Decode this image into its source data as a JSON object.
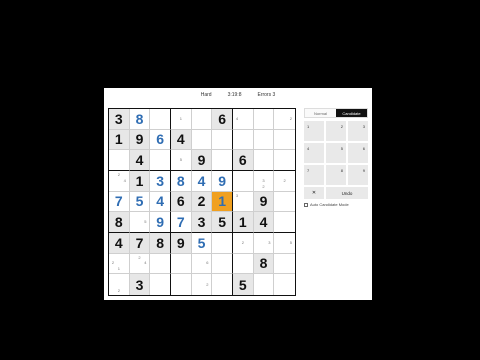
{
  "header": {
    "difficulty": "Hard",
    "timer": "3:19:8",
    "score": "Errors 3"
  },
  "board": {
    "rows": [
      [
        {
          "v": "3",
          "t": "given"
        },
        {
          "v": "8",
          "t": "user"
        },
        {
          "n": [
            "",
            "",
            " ",
            "",
            "",
            "",
            " ",
            "",
            ""
          ]
        },
        {
          "n": [
            "",
            "",
            "",
            "",
            "1",
            "",
            "",
            "",
            ""
          ]
        },
        {
          "v": ""
        },
        {
          "v": "6",
          "t": "given"
        },
        {
          "n": [
            "",
            "",
            "",
            "4",
            "",
            "",
            "",
            "",
            ""
          ]
        },
        {
          "v": ""
        },
        {
          "n": [
            "",
            "",
            "",
            "",
            "",
            "2",
            "",
            "",
            ""
          ]
        }
      ],
      [
        {
          "v": "1",
          "t": "given"
        },
        {
          "v": "9",
          "t": "given"
        },
        {
          "v": "6",
          "t": "user"
        },
        {
          "v": "4",
          "t": "given"
        },
        {
          "v": ""
        },
        {
          "v": ""
        },
        {
          "v": ""
        },
        {
          "v": ""
        },
        {
          "v": ""
        }
      ],
      [
        {
          "v": ""
        },
        {
          "v": "4",
          "t": "given"
        },
        {
          "v": ""
        },
        {
          "n": [
            "",
            "",
            "",
            "",
            "5",
            "",
            "",
            "",
            ""
          ]
        },
        {
          "v": "9",
          "t": "given"
        },
        {
          "v": ""
        },
        {
          "v": "6",
          "t": "given"
        },
        {
          "v": ""
        },
        {
          "v": ""
        }
      ],
      [
        {
          "n": [
            "",
            "2",
            "",
            "",
            "",
            "4",
            "",
            "",
            ""
          ]
        },
        {
          "v": "1",
          "t": "given"
        },
        {
          "v": "3",
          "t": "user"
        },
        {
          "v": "8",
          "t": "user"
        },
        {
          "v": "4",
          "t": "user"
        },
        {
          "v": "9",
          "t": "user"
        },
        {
          "v": ""
        },
        {
          "n": [
            "",
            "",
            "",
            "",
            "3",
            "",
            "",
            "2",
            ""
          ]
        },
        {
          "n": [
            "",
            "",
            "",
            "",
            "2",
            "",
            "",
            "",
            ""
          ]
        }
      ],
      [
        {
          "v": "7",
          "t": "user"
        },
        {
          "v": "5",
          "t": "user"
        },
        {
          "v": "4",
          "t": "user"
        },
        {
          "v": "6",
          "t": "given"
        },
        {
          "v": "2",
          "t": "given"
        },
        {
          "v": "1",
          "t": "selected"
        },
        {
          "n": [
            "3",
            "",
            "",
            "",
            "",
            "",
            "",
            "",
            ""
          ]
        },
        {
          "v": "9",
          "t": "given"
        },
        {
          "v": ""
        }
      ],
      [
        {
          "v": "8",
          "t": "given"
        },
        {
          "n": [
            "",
            "",
            "",
            "",
            "",
            "5",
            "",
            "",
            ""
          ]
        },
        {
          "v": "9",
          "t": "user"
        },
        {
          "v": "7",
          "t": "user"
        },
        {
          "v": "3",
          "t": "given"
        },
        {
          "v": "5",
          "t": "given"
        },
        {
          "v": "1",
          "t": "given"
        },
        {
          "v": "4",
          "t": "given"
        },
        {
          "v": ""
        }
      ],
      [
        {
          "v": "4",
          "t": "given"
        },
        {
          "v": "7",
          "t": "given"
        },
        {
          "v": "8",
          "t": "given"
        },
        {
          "v": "9",
          "t": "given"
        },
        {
          "v": "5",
          "t": "user"
        },
        {
          "v": ""
        },
        {
          "n": [
            "",
            "",
            "",
            "",
            "2",
            "",
            "",
            "",
            ""
          ]
        },
        {
          "n": [
            "",
            "",
            "",
            "",
            "",
            "3",
            "",
            "",
            ""
          ]
        },
        {
          "n": [
            "",
            "",
            "",
            "",
            "",
            "5",
            "",
            "",
            ""
          ]
        }
      ],
      [
        {
          "n": [
            "",
            "",
            "",
            "2",
            "",
            "",
            "",
            "1",
            ""
          ]
        },
        {
          "n": [
            "",
            "2",
            "",
            "",
            "",
            "4",
            "",
            "",
            ""
          ]
        },
        {
          "v": ""
        },
        {
          "v": ""
        },
        {
          "n": [
            "",
            "",
            "",
            "",
            "",
            "6",
            "",
            "",
            ""
          ]
        },
        {
          "v": ""
        },
        {
          "v": ""
        },
        {
          "v": "8",
          "t": "given"
        },
        {
          "v": ""
        }
      ],
      [
        {
          "n": [
            "",
            "",
            "",
            "",
            "",
            "",
            "",
            "2",
            ""
          ]
        },
        {
          "v": "3",
          "t": "given"
        },
        {
          "v": ""
        },
        {
          "v": ""
        },
        {
          "n": [
            "",
            "",
            "",
            "",
            "",
            "2",
            "",
            "",
            ""
          ]
        },
        {
          "v": ""
        },
        {
          "v": "5",
          "t": "given"
        },
        {
          "v": ""
        },
        {
          "v": ""
        }
      ]
    ]
  },
  "side": {
    "mode_normal": "Normal",
    "mode_candidate": "Candidate",
    "keys": [
      "1",
      "2",
      "3",
      "4",
      "5",
      "6",
      "7",
      "8",
      "9"
    ],
    "erase_label": "✕",
    "undo_label": "Undo",
    "auto_label": "Auto Candidate Mode"
  }
}
